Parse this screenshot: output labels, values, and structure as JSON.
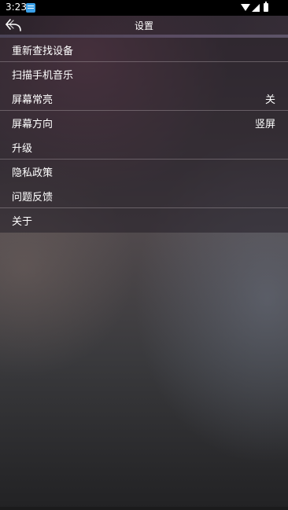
{
  "status_bar": {
    "time": "3:23"
  },
  "header": {
    "title": "设置",
    "back_icon": "back-arrow-icon"
  },
  "settings": [
    {
      "label": "重新查找设备",
      "value": ""
    },
    {
      "label": "扫描手机音乐",
      "value": ""
    },
    {
      "label": "屏幕常亮",
      "value": "关"
    },
    {
      "label": "屏幕方向",
      "value": "竖屏"
    },
    {
      "label": "升级",
      "value": ""
    },
    {
      "label": "隐私政策",
      "value": ""
    },
    {
      "label": "问题反馈",
      "value": ""
    },
    {
      "label": "关于",
      "value": ""
    }
  ],
  "colors": {
    "status_bar_bg": "#000000",
    "notification_icon": "#3aa0e8",
    "text": "#ffffff"
  }
}
